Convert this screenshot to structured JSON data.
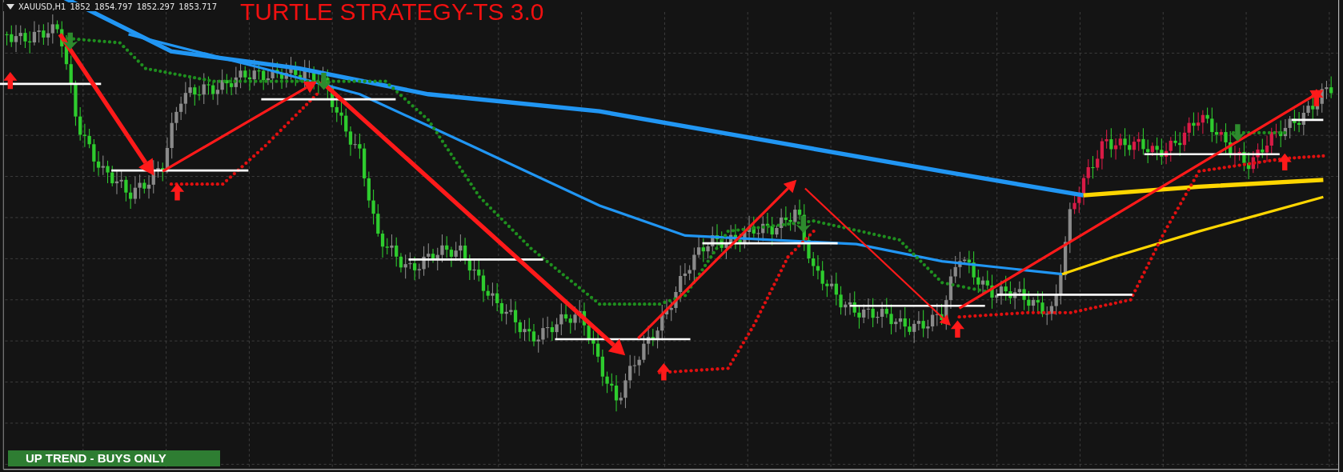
{
  "chart": {
    "symbol": "XAUUSD,H1",
    "prices": [
      "1852",
      "1854.797",
      "1852.297",
      "1853.717"
    ],
    "title": "TURTLE STRATEGY-TS 3.0"
  },
  "trend_banner": {
    "text": "UP TREND - BUYS ONLY",
    "kind": "up"
  }
}
